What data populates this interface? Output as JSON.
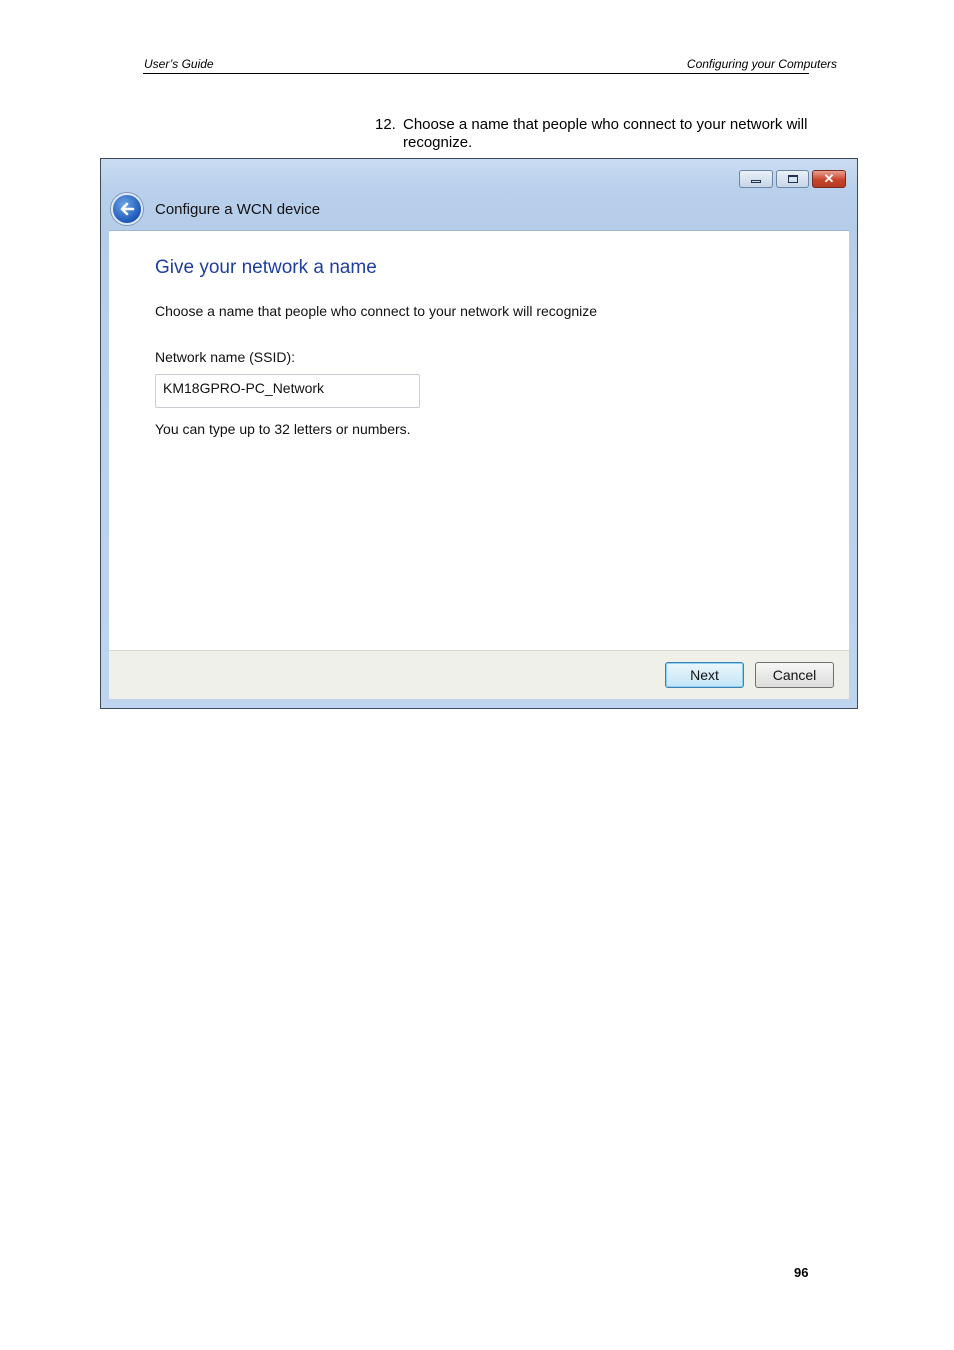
{
  "page": {
    "header_left": "User’s Guide",
    "header_right": "Configuring your Computers",
    "step_number": "12.",
    "step_text": "Choose a name that people who connect to your network will recognize.",
    "page_number": "96"
  },
  "window": {
    "title": "Configure a WCN device",
    "heading": "Give your network a name",
    "description": "Choose a name that people who connect to your network will recognize",
    "field_label": "Network name (SSID):",
    "field_value": "KM18GPRO-PC_Network",
    "hint": "You can type up to 32 letters or numbers.",
    "next_label": "Next",
    "cancel_label": "Cancel",
    "icons": {
      "back": "back-arrow-icon",
      "minimize": "minimize-icon",
      "maximize": "maximize-icon",
      "close": "close-icon"
    }
  },
  "colors": {
    "heading": "#1e3fa0",
    "close_button": "#c9452d"
  }
}
